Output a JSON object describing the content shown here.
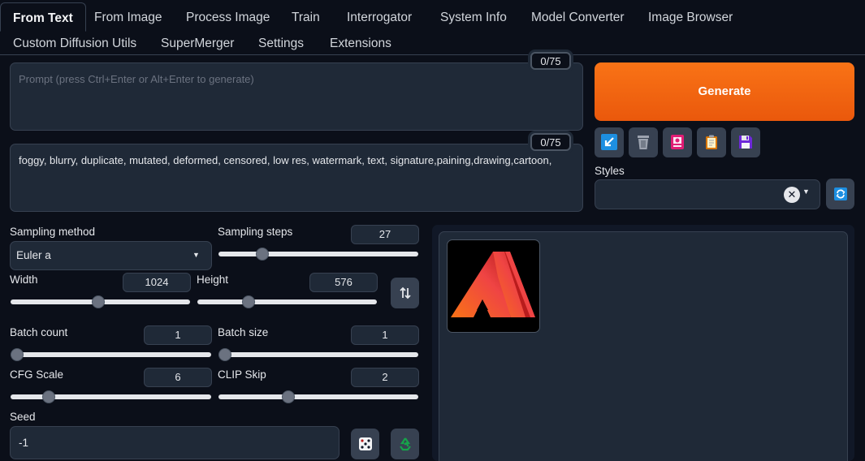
{
  "tabs": [
    {
      "label": "From Text",
      "active": true
    },
    {
      "label": "From Image"
    },
    {
      "label": "Process Image"
    },
    {
      "label": "Train"
    },
    {
      "label": "Interrogator"
    },
    {
      "label": "System Info"
    },
    {
      "label": "Model Converter"
    },
    {
      "label": "Image Browser"
    },
    {
      "label": "Custom Diffusion Utils"
    },
    {
      "label": "SuperMerger"
    },
    {
      "label": "Settings"
    },
    {
      "label": "Extensions"
    }
  ],
  "prompt": {
    "placeholder": "Prompt (press Ctrl+Enter or Alt+Enter to generate)",
    "value": "",
    "counter": "0/75"
  },
  "negative_prompt": {
    "value": "foggy, blurry, duplicate, mutated, deformed, censored, low res, watermark, text, signature,paining,drawing,cartoon,",
    "counter": "0/75"
  },
  "generate_label": "Generate",
  "toolbar_icons": [
    "arrow-icon",
    "trash-icon",
    "image-card-icon",
    "clipboard-icon",
    "floppy-disk-icon"
  ],
  "styles": {
    "label": "Styles",
    "value": ""
  },
  "sampling": {
    "label": "Sampling method",
    "value": "Euler a"
  },
  "steps": {
    "label": "Sampling steps",
    "value": "27",
    "fraction": 0.2
  },
  "width": {
    "label": "Width",
    "value": "1024",
    "fraction": 0.49
  },
  "height": {
    "label": "Height",
    "value": "576",
    "fraction": 0.27
  },
  "batch_count": {
    "label": "Batch count",
    "value": "1",
    "fraction": 0.0
  },
  "batch_size": {
    "label": "Batch size",
    "value": "1",
    "fraction": 0.0
  },
  "cfg_scale": {
    "label": "CFG Scale",
    "value": "6",
    "fraction": 0.17
  },
  "clip_skip": {
    "label": "CLIP Skip",
    "value": "2",
    "fraction": 0.34
  },
  "seed": {
    "label": "Seed",
    "value": "-1"
  },
  "colors": {
    "accent": "#f97316",
    "background": "#0b0f19",
    "panel": "#1f2937"
  }
}
